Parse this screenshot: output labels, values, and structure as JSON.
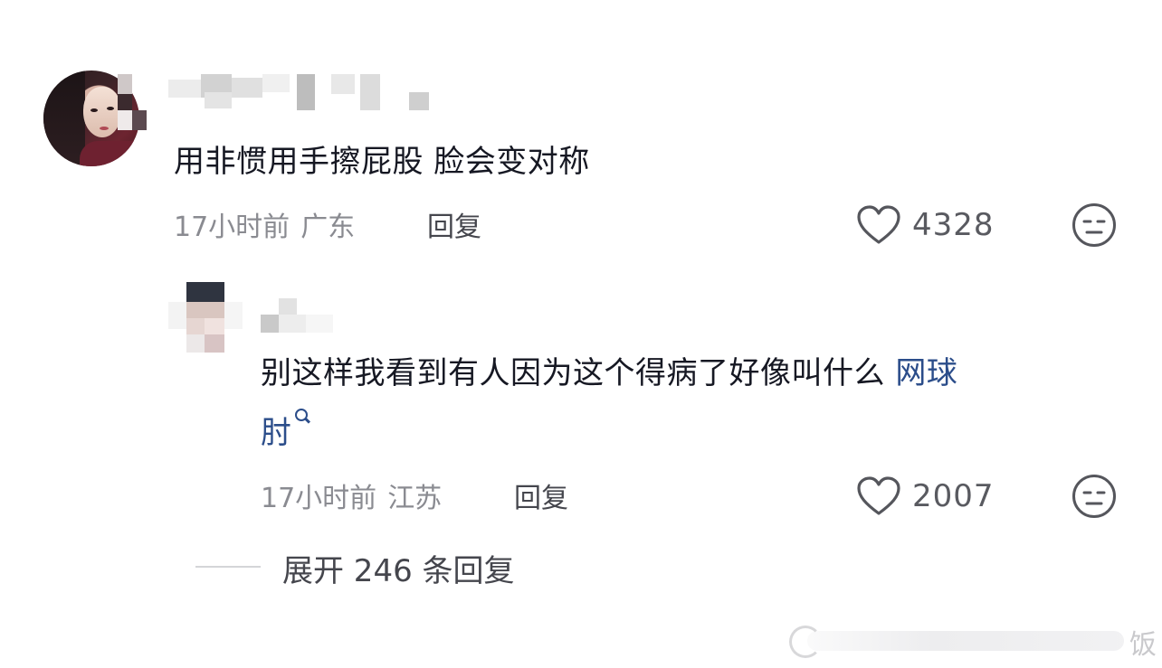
{
  "comments": [
    {
      "text": "用非惯用手擦屁股 脸会变对称",
      "time": "17小时前",
      "location": "广东",
      "reply_label": "回复",
      "likes": "4328"
    },
    {
      "text": "别这样我看到有人因为这个得病了好像叫什么",
      "link_line1": "网球",
      "link_line2": "肘",
      "time": "17小时前",
      "location": "江苏",
      "reply_label": "回复",
      "likes": "2007"
    }
  ],
  "expand_replies": "展开 246 条回复",
  "icons": {
    "like": "heart-outline-icon",
    "dislike": "neutral-face-icon",
    "search": "search-icon"
  },
  "colors": {
    "link": "#2b4d8a",
    "meta": "#8a8b91",
    "text": "#161823"
  },
  "watermark": {
    "text": "饭"
  }
}
